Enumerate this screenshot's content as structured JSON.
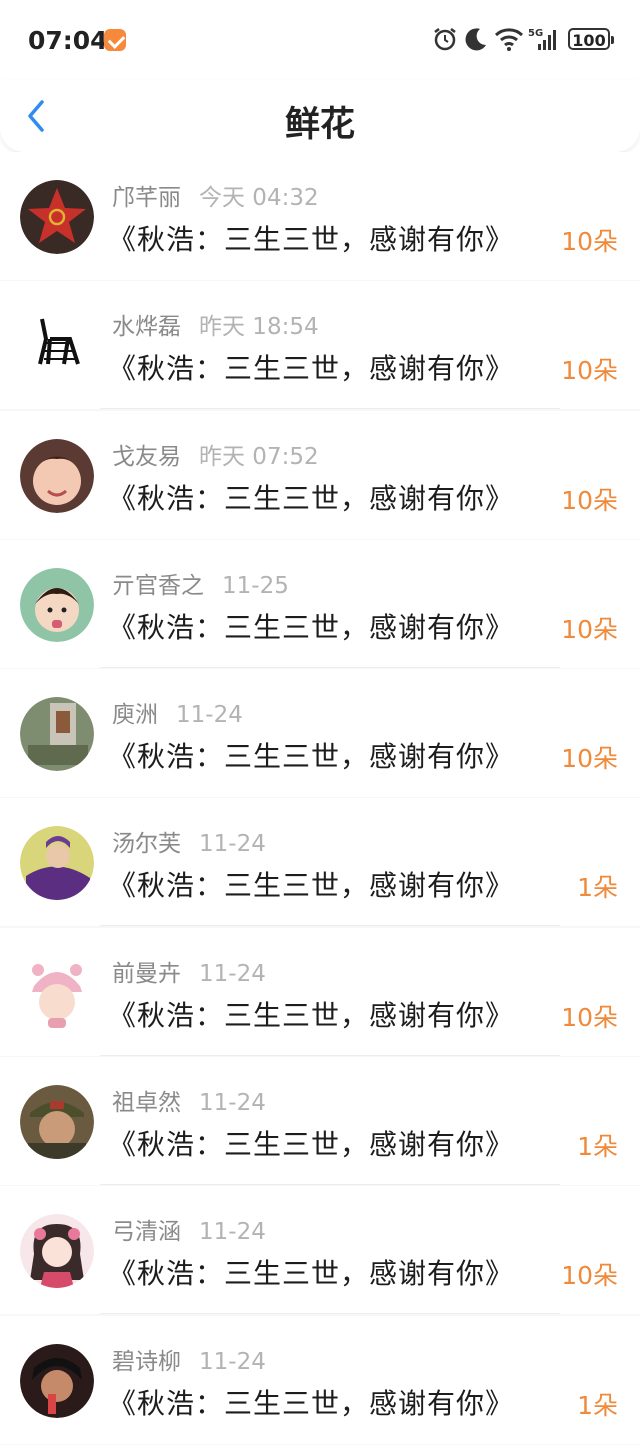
{
  "status": {
    "time": "07:04",
    "battery": "100",
    "network": "5G"
  },
  "header": {
    "title": "鲜花"
  },
  "flowers": [
    {
      "name": "邝芊丽",
      "date": "今天 04:32",
      "title": "《秋浩：三生三世，感谢有你》",
      "count": "10朵",
      "avatar": "star-badge"
    },
    {
      "name": "水烨磊",
      "date": "昨天 18:54",
      "title": "《秋浩：三生三世，感谢有你》",
      "count": "10朵",
      "avatar": "zebra"
    },
    {
      "name": "戈友易",
      "date": "昨天 07:52",
      "title": "《秋浩：三生三世，感谢有你》",
      "count": "10朵",
      "avatar": "child-face"
    },
    {
      "name": "亓官香之",
      "date": "11-25",
      "title": "《秋浩：三生三世，感谢有你》",
      "count": "10朵",
      "avatar": "kid-photo"
    },
    {
      "name": "庾洲",
      "date": "11-24",
      "title": "《秋浩：三生三世，感谢有你》",
      "count": "10朵",
      "avatar": "street-photo"
    },
    {
      "name": "汤尔芙",
      "date": "11-24",
      "title": "《秋浩：三生三世，感谢有你》",
      "count": "1朵",
      "avatar": "purple-dress"
    },
    {
      "name": "前曼卉",
      "date": "11-24",
      "title": "《秋浩：三生三世，感谢有你》",
      "count": "10朵",
      "avatar": "pink-hat-kid"
    },
    {
      "name": "祖卓然",
      "date": "11-24",
      "title": "《秋浩：三生三世，感谢有你》",
      "count": "1朵",
      "avatar": "soldier"
    },
    {
      "name": "弓清涵",
      "date": "11-24",
      "title": "《秋浩：三生三世，感谢有你》",
      "count": "10朵",
      "avatar": "anime-girl"
    },
    {
      "name": "碧诗柳",
      "date": "11-24",
      "title": "《秋浩：三生三世，感谢有你》",
      "count": "1朵",
      "avatar": "dark-portrait"
    }
  ],
  "colors": {
    "accent": "#f08a3a",
    "back_arrow": "#2f8cf0"
  }
}
